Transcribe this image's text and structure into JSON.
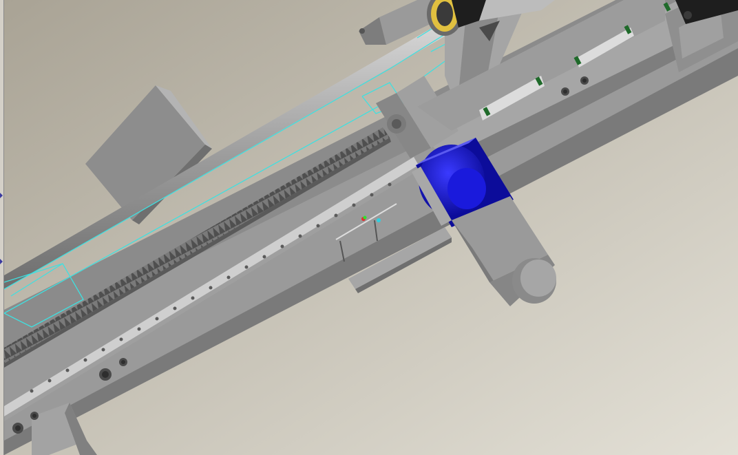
{
  "app": {
    "window_title": ""
  },
  "viewport": {
    "name": "3d-model-viewport",
    "background_top": "#a8a396",
    "background_bottom": "#dedbd0"
  },
  "model": {
    "description_visible": false,
    "colors": {
      "frame": "#8f8f8f",
      "frame_light": "#a9a9a9",
      "frame_dark": "#737373",
      "rail": "#cfcfcf",
      "rack": "#6b6b6b",
      "gearbox": "#1a1adc",
      "gearbox_dark": "#0c0c9a",
      "motor": "#9a9a9a",
      "selection": "#3fe0e0",
      "bearing_gold": "#e0c040",
      "slider_green": "#1f6a2a"
    }
  },
  "sidebar_edge": {
    "arrows": [
      "expand-arrow-icon",
      "expand-arrow-icon"
    ]
  }
}
